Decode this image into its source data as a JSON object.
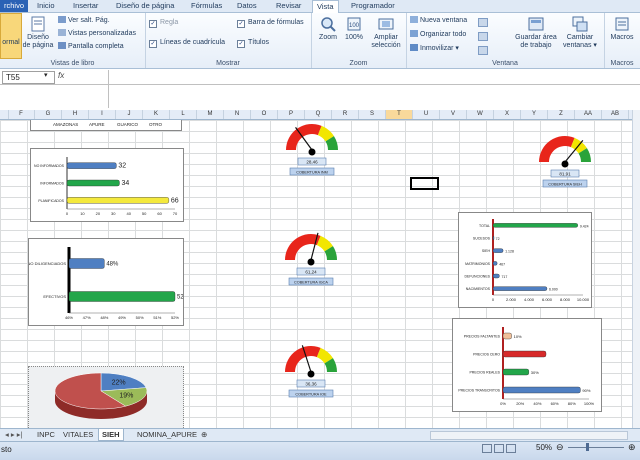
{
  "tabs": [
    {
      "label": "rchivo",
      "kind": "file"
    },
    {
      "label": "Inicio"
    },
    {
      "label": "Insertar"
    },
    {
      "label": "Diseño de página"
    },
    {
      "label": "Fórmulas"
    },
    {
      "label": "Datos"
    },
    {
      "label": "Revisar"
    },
    {
      "label": "Vista",
      "kind": "active"
    },
    {
      "label": "Programador"
    }
  ],
  "ribbon": {
    "views": {
      "normal": "ormal",
      "page_layout_1": "Diseño",
      "page_layout_2": "de página",
      "page_break": "Ver salt. Pág.",
      "custom_views": "Vistas personalizadas",
      "full_screen": "Pantalla completa",
      "label": "Vistas de libro"
    },
    "show": {
      "ruler": "Regla",
      "gridlines": "Líneas de cuadrícula",
      "formula_bar": "Barra de fórmulas",
      "headings": "Títulos",
      "label": "Mostrar"
    },
    "zoom": {
      "zoom": "Zoom",
      "hundred": "100%",
      "selection_1": "Ampliar",
      "selection_2": "selección",
      "label": "Zoom"
    },
    "window": {
      "new_window": "Nueva ventana",
      "arrange_all": "Organizar todo",
      "freeze": "Inmovilizar",
      "save_ws_1": "Guardar área",
      "save_ws_2": "de trabajo",
      "switch_1": "Cambiar",
      "switch_2": "ventanas",
      "label": "Ventana"
    },
    "macros": {
      "button": "Macros",
      "label": "Macros"
    }
  },
  "formula_bar": {
    "name_box": "T55",
    "fx": "fx",
    "value": ""
  },
  "columns": [
    "F",
    "G",
    "H",
    "I",
    "J",
    "K",
    "L",
    "M",
    "N",
    "O",
    "P",
    "Q",
    "R",
    "S",
    "T",
    "U",
    "V",
    "W",
    "X",
    "Y",
    "Z",
    "AA",
    "AB"
  ],
  "sheets": [
    "INPC",
    "VITALES",
    "SIEH",
    "NOMINA_APURE"
  ],
  "active_sheet": "SIEH",
  "status": {
    "left": "sto",
    "zoom": "50%"
  },
  "colors": {
    "red": "#e8251b",
    "yellow": "#f2e600",
    "green": "#2aa33a",
    "bar_blue": "#4f7fc2",
    "bar_green": "#22a64a",
    "bar_yellow": "#f4e93c",
    "bar_red": "#d72a2a",
    "bar_peach": "#f0c09a"
  },
  "top_strip_labels": [
    "AMAZONAS",
    "APURE",
    "GUARICO",
    "OTRO"
  ],
  "gauges": [
    {
      "value_label": "28,46",
      "caption": "COBERTURA INM",
      "value": 0.3
    },
    {
      "value_label": "81,91",
      "caption": "COBERTURA SIEH",
      "value": 0.72
    },
    {
      "value_label": "61,24",
      "caption": "COBERTURA IGCA",
      "value": 0.58
    },
    {
      "value_label": "36,36",
      "caption": "COBERTURA IOE",
      "value": 0.4
    }
  ],
  "chart_data": [
    {
      "type": "bar",
      "orientation": "horizontal",
      "categories": [
        "NO INFORMADOS",
        "INFORMADOS",
        "PLANIFICADOS"
      ],
      "values": [
        32,
        34,
        66
      ],
      "data_labels": [
        "32",
        "34",
        "66"
      ],
      "xlim": [
        0,
        70
      ],
      "xticks": [
        "0",
        "10",
        "20",
        "30",
        "40",
        "50",
        "60",
        "70"
      ]
    },
    {
      "type": "bar",
      "orientation": "horizontal",
      "categories": [
        "NO DILIGENCIADOS",
        "EFECTIVOS"
      ],
      "values": [
        48,
        52
      ],
      "data_labels": [
        "48%",
        "52%"
      ],
      "xlim": [
        46,
        52
      ],
      "xticks": [
        "46%",
        "47%",
        "48%",
        "49%",
        "50%",
        "51%",
        "52%"
      ]
    },
    {
      "type": "pie",
      "slices": [
        {
          "value": 22,
          "label": "22%"
        },
        {
          "value": 19,
          "label": "19%"
        },
        {
          "value": 59,
          "label": ""
        }
      ]
    },
    {
      "type": "bar",
      "orientation": "horizontal",
      "categories": [
        "TOTAL",
        "SUCESOS",
        "SIEH",
        "MATRIMONIOS",
        "DEFUNCIONES",
        "NACIMIENTOS"
      ],
      "values": [
        9424,
        72,
        1128,
        467,
        717,
        6000
      ],
      "data_labels": [
        "9.424",
        "72",
        "1.128",
        "467",
        "717",
        "6.000"
      ],
      "xlim": [
        0,
        10000
      ],
      "xticks": [
        "0",
        "2.000",
        "4.000",
        "6.000",
        "8.000",
        "10.000"
      ]
    },
    {
      "type": "bar",
      "orientation": "horizontal",
      "categories": [
        "PRECIOS FALTANTES",
        "PRECIOS CERO",
        "PRECIOS REALES",
        "PRECIOS TRANSCRITOS"
      ],
      "values": [
        10,
        50,
        30,
        90
      ],
      "data_labels": [
        "10%",
        "",
        "30%",
        "90%"
      ],
      "xlim": [
        0,
        100
      ],
      "xticks": [
        "0%",
        "20%",
        "40%",
        "60%",
        "80%",
        "100%"
      ]
    }
  ]
}
